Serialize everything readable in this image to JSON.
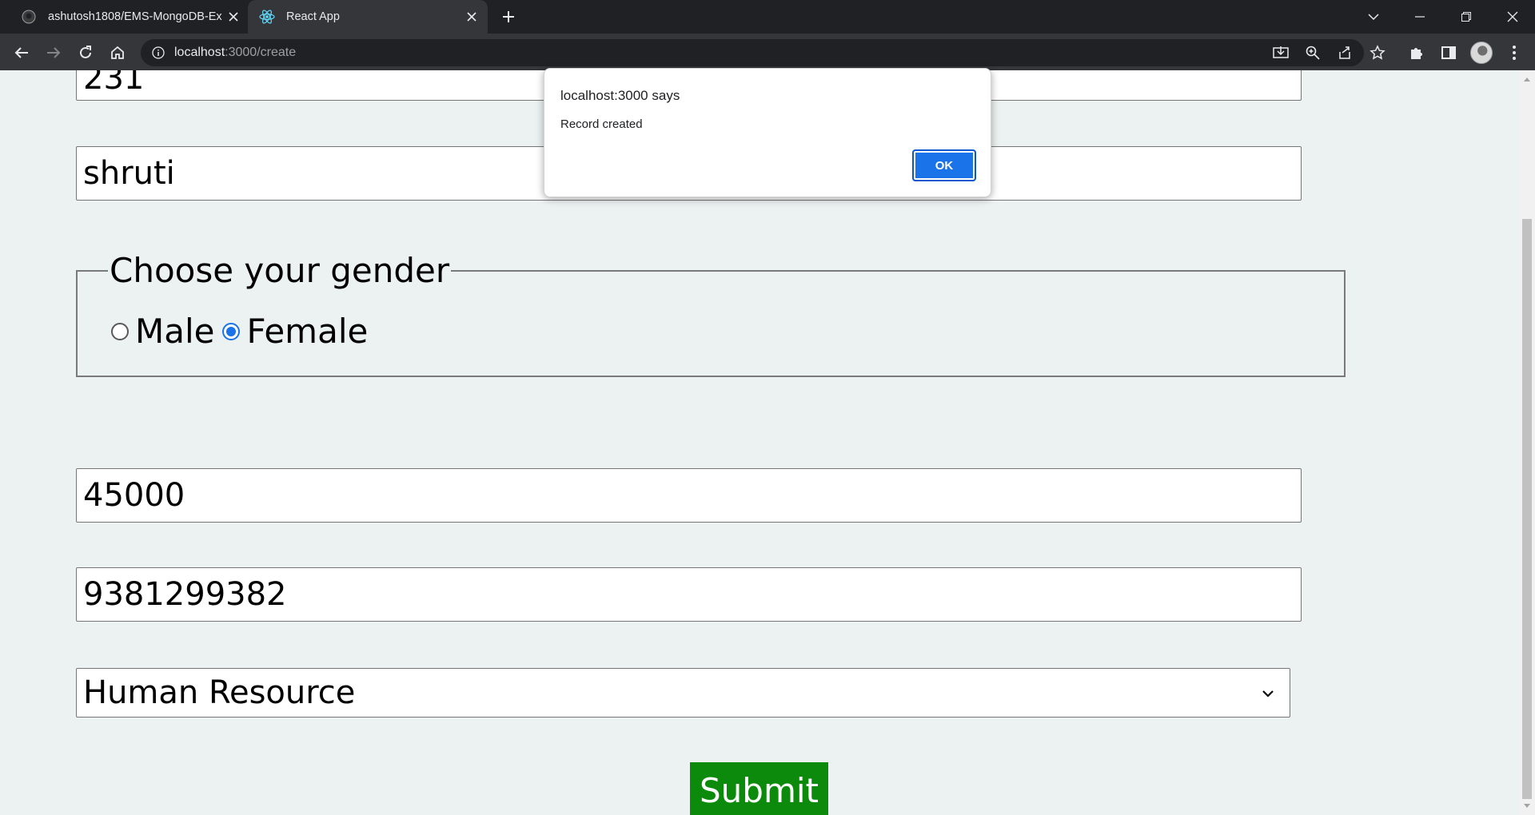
{
  "browser": {
    "tabs": [
      {
        "title": "ashutosh1808/EMS-MongoDB-Ex",
        "active": false,
        "icon": "github-icon"
      },
      {
        "title": "React App",
        "active": true,
        "icon": "react-icon"
      }
    ],
    "url_host": "localhost",
    "url_path": ":3000/create"
  },
  "form": {
    "id_value": "231",
    "name_value": "shruti",
    "gender_legend": "Choose your gender",
    "gender_options": [
      "Male",
      "Female"
    ],
    "gender_selected": "Female",
    "salary_value": "45000",
    "phone_value": "9381299382",
    "department_selected": "Human Resource",
    "submit_label": "Submit"
  },
  "dialog": {
    "title": "localhost:3000 says",
    "message": "Record created",
    "ok_label": "OK"
  },
  "colors": {
    "submit_bg": "#0b8a0b",
    "page_bg": "#ecf2f1",
    "accent": "#1a73e8"
  }
}
